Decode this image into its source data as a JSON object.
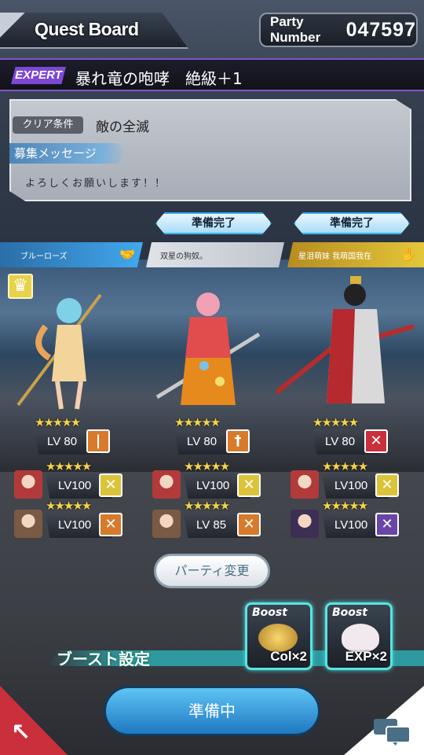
{
  "header": {
    "title": "Quest Board",
    "party_label": "Party Number",
    "party_number": "047597"
  },
  "quest": {
    "difficulty_tag": "EXPERT",
    "name": "暴れ竜の咆哮　絶級＋1"
  },
  "conditions": {
    "clear_tag": "クリア条件",
    "clear_text": "敵の全滅",
    "recruit_tag": "募集メッセージ",
    "message": "よろしくお願いします！！"
  },
  "ready_buttons": [
    "準備完了",
    "準備完了"
  ],
  "players": [
    {
      "name": "ブルーローズ",
      "bar_color": "#42a8ee"
    },
    {
      "name": "双星の狗奴。",
      "bar_color": "#cfd3d8"
    },
    {
      "name": "星泪萌妹 我萌国我在",
      "bar_color": "#e5c73a"
    }
  ],
  "members": [
    {
      "stars": "★★★★★",
      "level": "LV 80",
      "weapon_icon": "sword-icon",
      "weapon_color": "orange",
      "supports": [
        {
          "portrait": "red",
          "stars": "★★★★★",
          "level": "LV100",
          "icon": "cross-swords-icon",
          "color": "yellow"
        },
        {
          "portrait": "brown",
          "stars": "★★★★★",
          "level": "LV100",
          "icon": "cross-swords-icon",
          "color": "orange"
        }
      ]
    },
    {
      "stars": "★★★★★",
      "level": "LV 80",
      "weapon_icon": "mace-icon",
      "weapon_color": "orange",
      "supports": [
        {
          "portrait": "red",
          "stars": "★★★★★",
          "level": "LV100",
          "icon": "cross-swords-icon",
          "color": "yellow"
        },
        {
          "portrait": "brown",
          "stars": "★★★★★",
          "level": "LV 85",
          "icon": "cross-swords-icon",
          "color": "orange"
        }
      ]
    },
    {
      "stars": "★★★★★",
      "level": "LV 80",
      "weapon_icon": "dual-sword-icon",
      "weapon_color": "red",
      "supports": [
        {
          "portrait": "red",
          "stars": "★★★★★",
          "level": "LV100",
          "icon": "cross-swords-icon",
          "color": "yellow"
        },
        {
          "portrait": "dark",
          "stars": "★★★★★",
          "level": "LV100",
          "icon": "cross-swords-icon",
          "color": "purple"
        }
      ]
    }
  ],
  "party_change_label": "パーティ変更",
  "boost": {
    "label": "ブースト設定",
    "items": [
      {
        "tag": "Boost",
        "value": "Col×2",
        "icon": "coins-icon"
      },
      {
        "tag": "Boost",
        "value": "EXP×2",
        "icon": "mascot-icon"
      }
    ]
  },
  "main_button_label": "準備中",
  "colors": {
    "accent_purple": "#7e47d4",
    "ready_blue": "#38b0ee",
    "boost_cyan": "#5ce2e0"
  }
}
